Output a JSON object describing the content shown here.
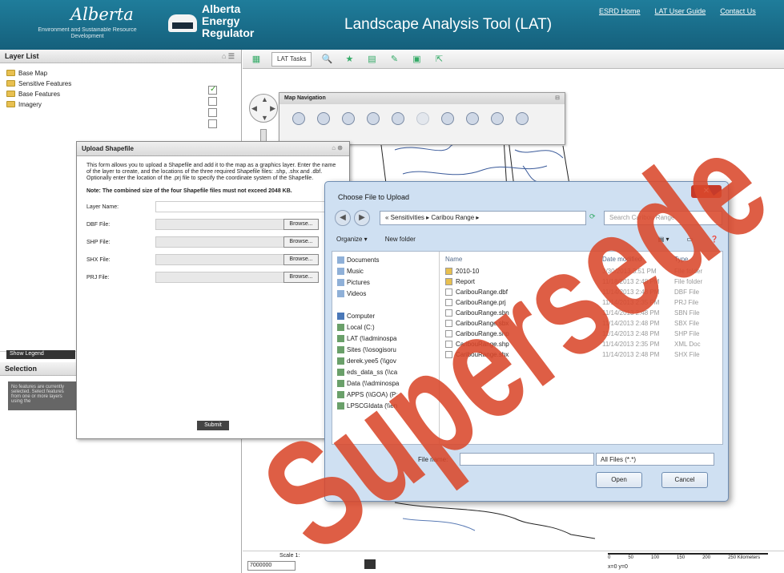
{
  "header": {
    "ab_logo": "Alberta",
    "ab_sub": "Environment and Sustainable Resource Development",
    "aer_logo": [
      "Alberta",
      "Energy",
      "Regulator"
    ],
    "title": "Landscape Analysis Tool (LAT)",
    "links": [
      "ESRD Home",
      "LAT User Guide",
      "Contact Us"
    ]
  },
  "layer_list": {
    "title": "Layer List",
    "items": [
      "Base Map",
      "Sensitive Features",
      "Base Features",
      "Imagery"
    ]
  },
  "legend_button": "Show Legend",
  "selection": {
    "title": "Selection",
    "text": "No features are currently selected. Select features from one or more layers using the"
  },
  "toolbar": {
    "lat_tasks": "LAT Tasks"
  },
  "map_nav": {
    "title": "Map Navigation"
  },
  "upload": {
    "title": "Upload Shapefile",
    "desc": "This form allows you to upload a Shapefile and add it to the map as a graphics layer. Enter the name of the layer to create, and the locations of the three required Shapefile files: .shp, .shx and .dbf. Optionally enter the location of the .prj file to specify the coordinate system of the Shapefile.",
    "note": "Note: The combined size of the four Shapefile files must not exceed 2048 KB.",
    "fields": [
      "Layer Name:",
      "DBF File:",
      "SHP File:",
      "SHX File:",
      "PRJ File:"
    ],
    "browse": "Browse...",
    "submit": "Submit"
  },
  "file_dialog": {
    "title": "Choose File to Upload",
    "breadcrumb": "« Sensitivities ▸ Caribou Range ▸",
    "search_placeholder": "Search Caribou Range",
    "organize": "Organize ▾",
    "new_folder": "New folder",
    "tree": [
      "Documents",
      "Music",
      "Pictures",
      "Videos",
      "",
      "Computer",
      "Local (C:)",
      "LAT (\\\\adminospa",
      "Sites (\\\\osogisoru",
      "derek.yee5 (\\\\gov",
      "eds_data_ss (\\\\ca",
      "Data (\\\\adminospa",
      "APPS (\\\\GOA) (P:",
      "LPSCGIdata (\\\\en"
    ],
    "columns": [
      "Name",
      "Date modified",
      "Type"
    ],
    "files": [
      {
        "name": "2010-10",
        "date": "3/30/2013 3:51 PM",
        "type": "File folder",
        "kind": "folder"
      },
      {
        "name": "Report",
        "date": "11/18/2013 2:48 PM",
        "type": "File folder",
        "kind": "folder"
      },
      {
        "name": "CaribouRange.dbf",
        "date": "11/14/2013 2:48 PM",
        "type": "DBF File",
        "kind": "file"
      },
      {
        "name": "CaribouRange.prj",
        "date": "11/14/2013 2:35 PM",
        "type": "PRJ File",
        "kind": "file"
      },
      {
        "name": "CaribouRange.sbn",
        "date": "11/14/2013 2:48 PM",
        "type": "SBN File",
        "kind": "file"
      },
      {
        "name": "CaribouRange.sbx",
        "date": "11/14/2013 2:48 PM",
        "type": "SBX File",
        "kind": "file"
      },
      {
        "name": "CaribouRange.shp",
        "date": "11/14/2013 2:48 PM",
        "type": "SHP File",
        "kind": "file"
      },
      {
        "name": "CaribouRange.shp",
        "date": "11/14/2013 2:35 PM",
        "type": "XML Doc",
        "kind": "file"
      },
      {
        "name": "CaribouRange.shx",
        "date": "11/14/2013 2:48 PM",
        "type": "SHX File",
        "kind": "file"
      }
    ],
    "file_name_label": "File name:",
    "file_type": "All Files (*.*)",
    "open": "Open",
    "cancel": "Cancel"
  },
  "scale": {
    "label": "Scale 1:",
    "value": "7000000",
    "coords": "x=0 y=0",
    "ticks": [
      "0",
      "50",
      "100",
      "150",
      "200",
      "250 Kilometers"
    ]
  },
  "watermark": "Supersede",
  "colors": {
    "header": "#1f7d9b",
    "watermark": "#d9482b"
  }
}
